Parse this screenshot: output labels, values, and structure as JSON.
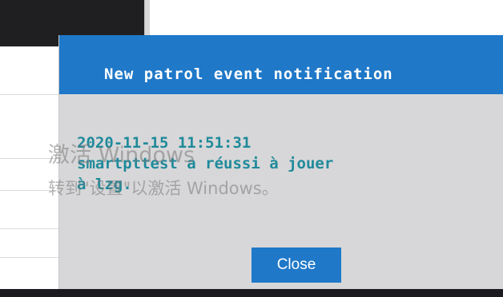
{
  "dialog": {
    "title": "New patrol event notification",
    "message_timestamp": "2020-11-15 11:51:31",
    "message_line1": "smartpttest a réussi à jouer",
    "message_line2": "à lzg.",
    "close_label": "Close"
  },
  "watermark": {
    "line1": "激活 Windows",
    "line2": "转到\"设置\"以激活 Windows。"
  },
  "colors": {
    "header": "#1f78c8",
    "dialog_body": "#d7d7d9",
    "message_text": "#1f8a9a"
  }
}
